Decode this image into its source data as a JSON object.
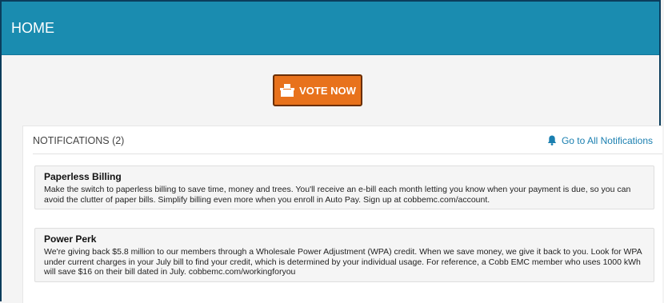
{
  "header": {
    "title": "HOME"
  },
  "vote": {
    "label": "VOTE NOW",
    "icon": "ballot-box-icon",
    "color": "#e8721c"
  },
  "notifications": {
    "title": "NOTIFICATIONS (2)",
    "link_label": "Go to All Notifications",
    "link_icon": "bell-icon",
    "items": [
      {
        "title": "Paperless Billing",
        "body": "Make the switch to paperless billing to save time, money and trees. You'll receive an e-bill each month letting you know when your payment is due, so you can avoid the clutter of paper bills. Simplify billing even more when you enroll in Auto Pay. Sign up at cobbemc.com/account."
      },
      {
        "title": "Power Perk",
        "body": "We're giving back $5.8 million to our members through a Wholesale Power Adjustment (WPA) credit. When we save money, we give it back to you. Look for WPA under current charges in your July bill to find your credit, which is determined by your individual usage. For reference, a Cobb EMC member who uses 1000 kWh will save $16 on their bill dated in July. cobbemc.com/workingforyou"
      }
    ]
  },
  "colors": {
    "header_bg": "#1a8cb0",
    "accent_link": "#1a7fb0"
  }
}
